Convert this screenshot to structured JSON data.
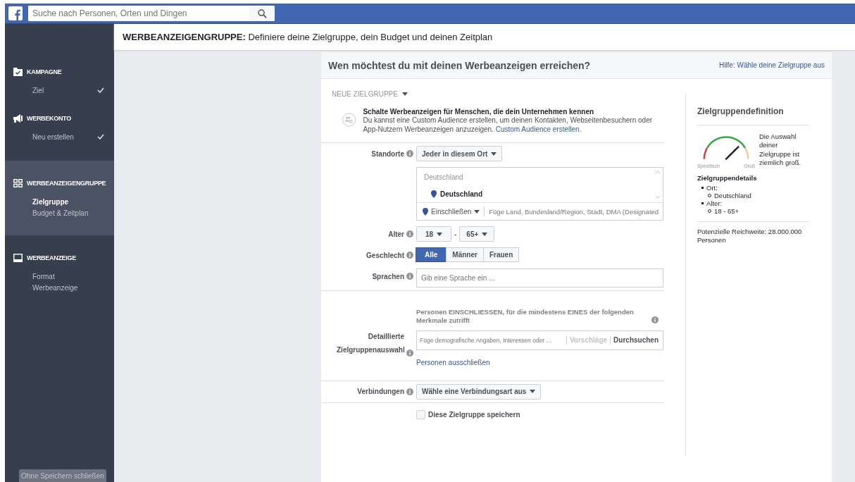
{
  "top_bar": {
    "search_placeholder": "Suche nach Personen, Orten und Dingen"
  },
  "sidebar": {
    "sections": [
      {
        "kind": "campaign",
        "title": "KAMPAGNE",
        "selected": false,
        "items": [
          {
            "label": "Ziel",
            "selected": false,
            "done": true
          }
        ]
      },
      {
        "kind": "account",
        "title": "WERBEKONTO",
        "selected": false,
        "items": [
          {
            "label": "Neu erstellen",
            "selected": false,
            "done": true
          }
        ]
      },
      {
        "kind": "adset",
        "title": "WERBEANZEIGENGRUPPE",
        "selected": true,
        "items": [
          {
            "label": "Zielgruppe",
            "selected": true,
            "done": false
          },
          {
            "label": "Budget & Zeitplan",
            "selected": false,
            "done": false
          }
        ]
      },
      {
        "kind": "ad",
        "title": "WERBEANZEIGE",
        "selected": false,
        "items": [
          {
            "label": "Format",
            "selected": false,
            "done": false
          },
          {
            "label": "Werbeanzeige",
            "selected": false,
            "done": false
          }
        ]
      }
    ],
    "close_button": "Ohne Speichern schließen"
  },
  "header": {
    "title": "**WERBEANZEIGENGRUPPE:** Definiere deine Zielgruppe, dein Budget und deinen Zeitplan"
  },
  "audience_card": {
    "heading": "Wen möchtest du mit deinen Werbeanzeigen erreichen?",
    "help_link": "Hilfe: Wähle deine Zielgruppe aus",
    "new_audience_dropdown": "NEUE ZIELGRUPPE",
    "custom_audience": {
      "title": "Schalte Werbeanzeigen für Menschen, die dein Unternehmen kennen",
      "text": "Du kannst eine Custom Audience erstellen, um deinen Kontakten, Webseitenbesuchern oder App-Nutzern Werbeanzeigen anzuzeigen.",
      "link": "Custom Audience erstellen."
    },
    "locations": {
      "label": "Standorte",
      "dropdown": "Jeder in diesem Ort",
      "group": "Deutschland",
      "selected_location": "Deutschland",
      "include_dropdown": "Einschließen",
      "placeholder": "Füge Land, Bundesland/Region, Stadt, DMA (Designated"
    },
    "age": {
      "label": "Alter",
      "from": "18",
      "separator": "-",
      "to": "65+"
    },
    "gender": {
      "label": "Geschlecht",
      "options": [
        {
          "label": "Alle",
          "selected": true
        },
        {
          "label": "Männer",
          "selected": false
        },
        {
          "label": "Frauen",
          "selected": false
        }
      ]
    },
    "languages": {
      "label": "Sprachen",
      "placeholder": "Gib eine Sprache ein ..."
    },
    "detailed_targeting": {
      "label": "Detaillierte Zielgruppenauswahl",
      "hint": "Personen EINSCHLIESSEN, für die mindestens EINES der folgenden Merkmale zutrifft",
      "placeholder": "Füge demografische Angaben, Interessen oder ...",
      "suggestions_link": "Vorschläge",
      "browse_link": "Durchsuchen",
      "exclude_link": "Personen ausschließen"
    },
    "connections": {
      "label": "Verbindungen",
      "dropdown": "Wähle eine Verbindungsart aus"
    },
    "save_audience": {
      "label": "Diese Zielgruppe speichern",
      "checked": false
    }
  },
  "definition_panel": {
    "title": "Zielgruppendefinition",
    "gauge": {
      "level": 0.75,
      "left_label": "Spezifisch",
      "right_label": "Groß",
      "text": "Die Auswahl deiner Zielgruppe ist ziemlich groß."
    },
    "details_title": "Zielgruppendetails",
    "details": [
      {
        "label": "Ort:",
        "children": [
          {
            "label": "Deutschland"
          }
        ]
      },
      {
        "label": "Alter:",
        "children": [
          {
            "label": "18 - 65+"
          }
        ]
      }
    ],
    "reach": "Potenzielle Reichweite: 28.000.000 Personen"
  }
}
